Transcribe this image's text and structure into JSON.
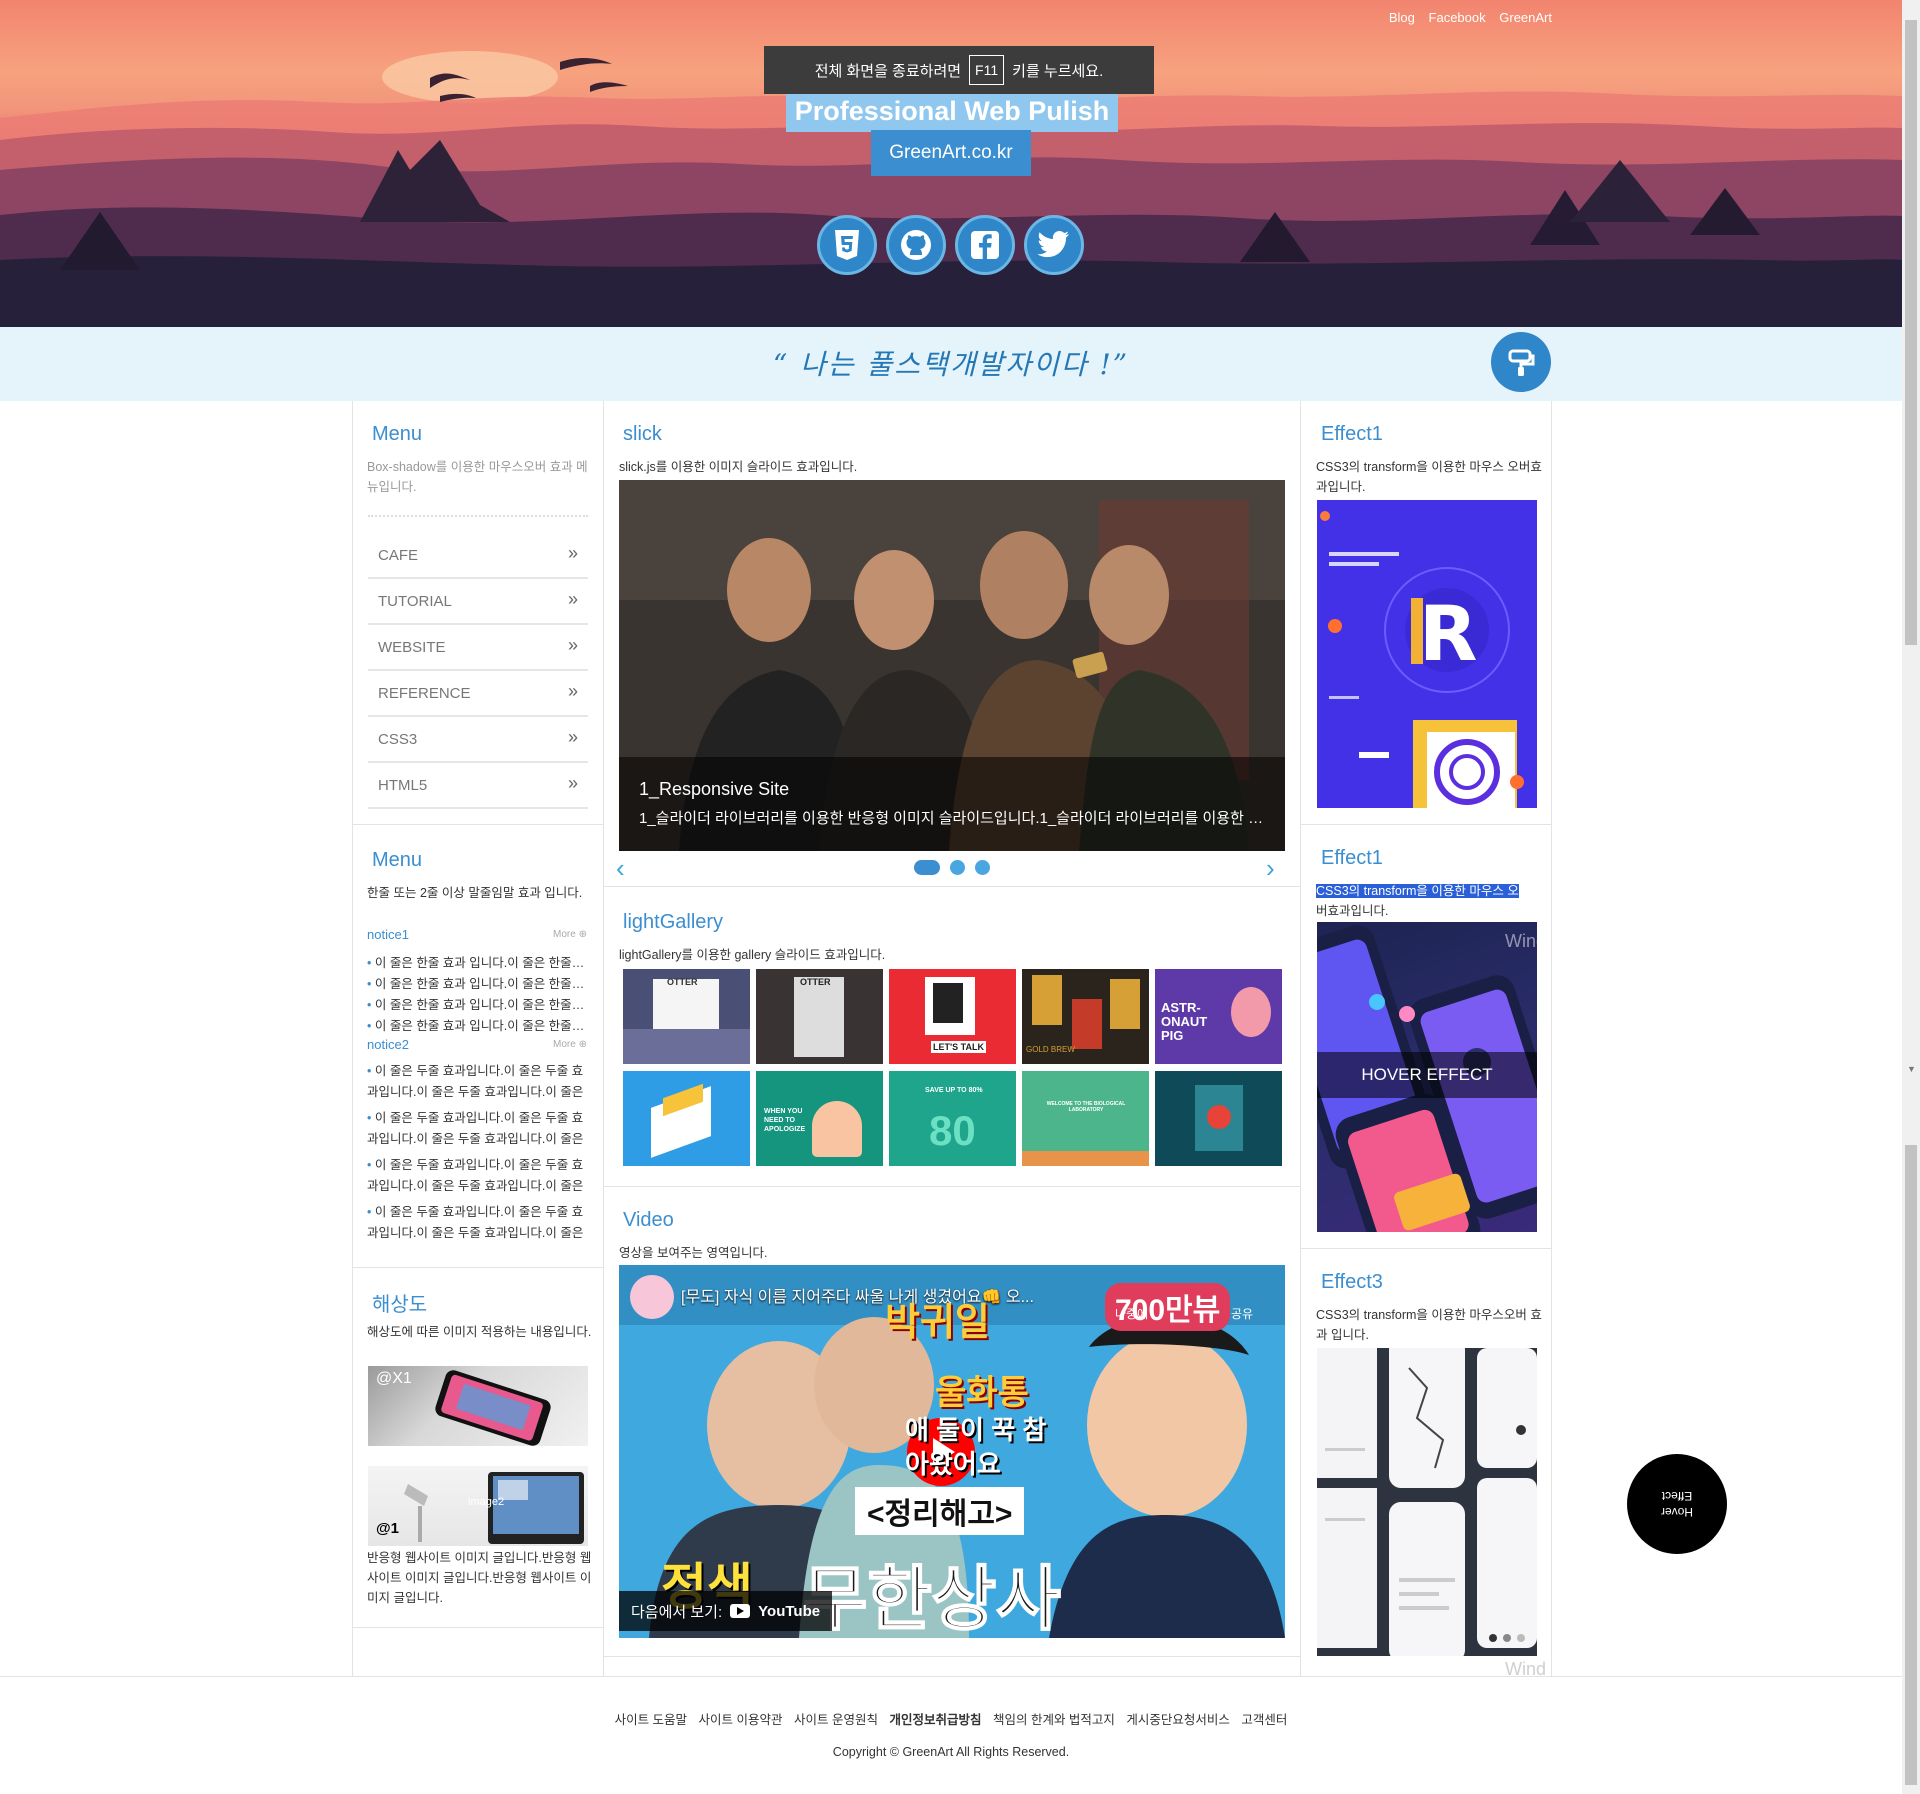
{
  "header": {
    "toplinks": [
      "Blog",
      "Facebook",
      "GreenArt"
    ],
    "fullscreen_notice_pre": "전체 화면을 종료하려면",
    "fullscreen_key": "F11",
    "fullscreen_notice_post": "키를 누르세요.",
    "title": "Professional Web Pulish",
    "subtitle": "GreenArt.co.kr",
    "social_icons": [
      "html5-icon",
      "github-icon",
      "facebook-icon",
      "twitter-icon"
    ]
  },
  "quote": "“ 나는 풀스택개발자이다 !”",
  "left": {
    "menu1": {
      "title": "Menu",
      "desc": "Box-shadow를 이용한 마우스오버 효과 메뉴입니다.",
      "items": [
        "CAFE",
        "TUTORIAL",
        "WEBSITE",
        "REFERENCE",
        "CSS3",
        "HTML5"
      ]
    },
    "menu2": {
      "title": "Menu",
      "desc": "한줄 또는 2줄 이상 말줄임말 효과 입니다.",
      "notice1": "notice1",
      "notice2": "notice2",
      "more": "More",
      "one_line": "이 줄은 한줄 효과 입니다.이 줄은 한줄 효과 입니다.",
      "two_line": "이 줄은 두줄 효과입니다.이 줄은 두줄 효과입니다.이 줄은 두줄 효과입니다.이 줄은 두줄 효과입니다."
    },
    "resolution": {
      "title": "해상도",
      "desc": "해상도에 따른 이미지 적용하는 내용입니다.",
      "img1_label": "@X1",
      "img2_label": "@1",
      "img2_sub": "image2",
      "bottom_text": "반응형 웹사이트 이미지 글입니다.반응형 웹사이트 이미지 글입니다.반응형 웹사이트 이미지 글입니다."
    }
  },
  "center": {
    "slick": {
      "title": "slick",
      "desc": "slick.js를 이용한 이미지 슬라이드 효과입니다.",
      "caption_title": "1_Responsive Site",
      "caption_desc": "1_슬라이더 라이브러리를 이용한 반응형 이미지 슬라이드입니다.1_슬라이더 라이브러리를 이용한 반응형 이미지 슬라이드입니다."
    },
    "gallery": {
      "title": "lightGallery",
      "desc": "lightGallery를 이용한 gallery 슬라이드 효과입니다.",
      "thumb_texts": [
        "OTTER",
        "OTTER",
        "LET'S TALK",
        "GOLD BREW",
        "ASTR-ONAUT PIG",
        "",
        "WHEN YOU NEED TO APOLOGIZE",
        "SAVE UP TO 80%",
        "WELCOME TO THE BIOLOGICAL LABORATORY",
        ""
      ]
    },
    "video": {
      "title": "Video",
      "desc": "영상을 보여주는 영역입니다.",
      "video_title": "[무도] 자식 이름 지어주다 싸울 나게 생겼어요👊 오...",
      "watch_on": "다음에서 보기:",
      "youtube": "YouTube",
      "later": "나중에",
      "share": "공유",
      "badge": "700만뷰",
      "text_a": "박귀일",
      "text_b": "울화통",
      "text_c": "애 둘이 꾹 참아왔어요",
      "text_d": "<정리해고>",
      "text_e": "무한상사",
      "text_f": "정색"
    }
  },
  "right": {
    "effect1": {
      "title": "Effect1",
      "desc": "CSS3의 transform을 이용한 마우스 오버효과입니다."
    },
    "effect2": {
      "title": "Effect1",
      "desc_sel": "CSS3의 transform을 이용한 마우스 오",
      "desc_rest": "버효과입니다.",
      "hover": "HOVER EFFECT"
    },
    "effect3": {
      "title": "Effect3",
      "desc": "CSS3의 transform을 이용한 마우스오버 효과 입니다."
    },
    "wind_text": "Wind"
  },
  "footer": {
    "links": [
      "사이트 도움말",
      "사이트 이용약관",
      "사이트 운영원칙",
      "개인정보취급방침",
      "책임의 한계와 법적고지",
      "게시중단요청서비스",
      "고객센터"
    ],
    "copyright": "Copyright © GreenArt All Rights Reserved."
  },
  "hover_circle": {
    "line1": "Hover",
    "line2": "Effect"
  },
  "colors": {
    "accent": "#3b8ed0",
    "quote_bg": "#e5f3fb",
    "dark": "#000000"
  }
}
